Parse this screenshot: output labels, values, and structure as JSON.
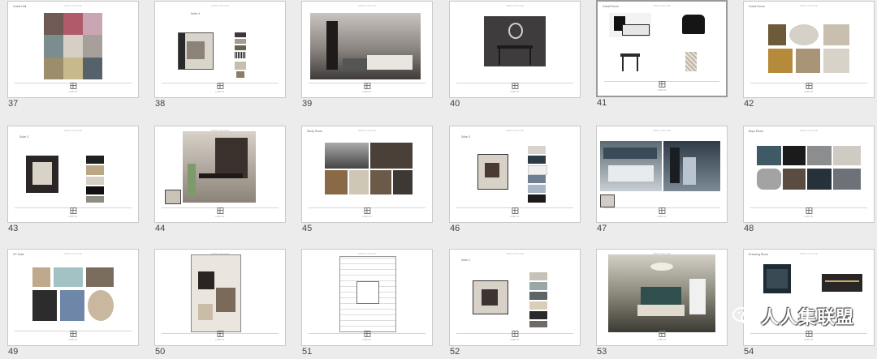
{
  "slides": [
    {
      "number": "37",
      "selected": false,
      "title": "Guest Hall"
    },
    {
      "number": "38",
      "selected": false,
      "title": "Suite 4"
    },
    {
      "number": "39",
      "selected": false,
      "title": ""
    },
    {
      "number": "40",
      "selected": false,
      "title": ""
    },
    {
      "number": "41",
      "selected": true,
      "title": "Guest Room"
    },
    {
      "number": "42",
      "selected": false,
      "title": "Guest Room"
    },
    {
      "number": "43",
      "selected": false,
      "title": "Suite 3"
    },
    {
      "number": "44",
      "selected": false,
      "title": ""
    },
    {
      "number": "45",
      "selected": false,
      "title": "Study Room"
    },
    {
      "number": "46",
      "selected": false,
      "title": "Suite 3"
    },
    {
      "number": "47",
      "selected": false,
      "title": ""
    },
    {
      "number": "48",
      "selected": false,
      "title": "Boys Room"
    },
    {
      "number": "49",
      "selected": false,
      "title": "VP Suite"
    },
    {
      "number": "50",
      "selected": false,
      "title": ""
    },
    {
      "number": "51",
      "selected": false,
      "title": ""
    },
    {
      "number": "52",
      "selected": false,
      "title": "Suite 2"
    },
    {
      "number": "53",
      "selected": false,
      "title": ""
    },
    {
      "number": "54",
      "selected": false,
      "title": "Dressing Room"
    }
  ],
  "brand": {
    "logo_text": "HIRCO",
    "header_text": "HIRCO PALACE"
  },
  "watermark": {
    "text": "人人集联盟"
  }
}
